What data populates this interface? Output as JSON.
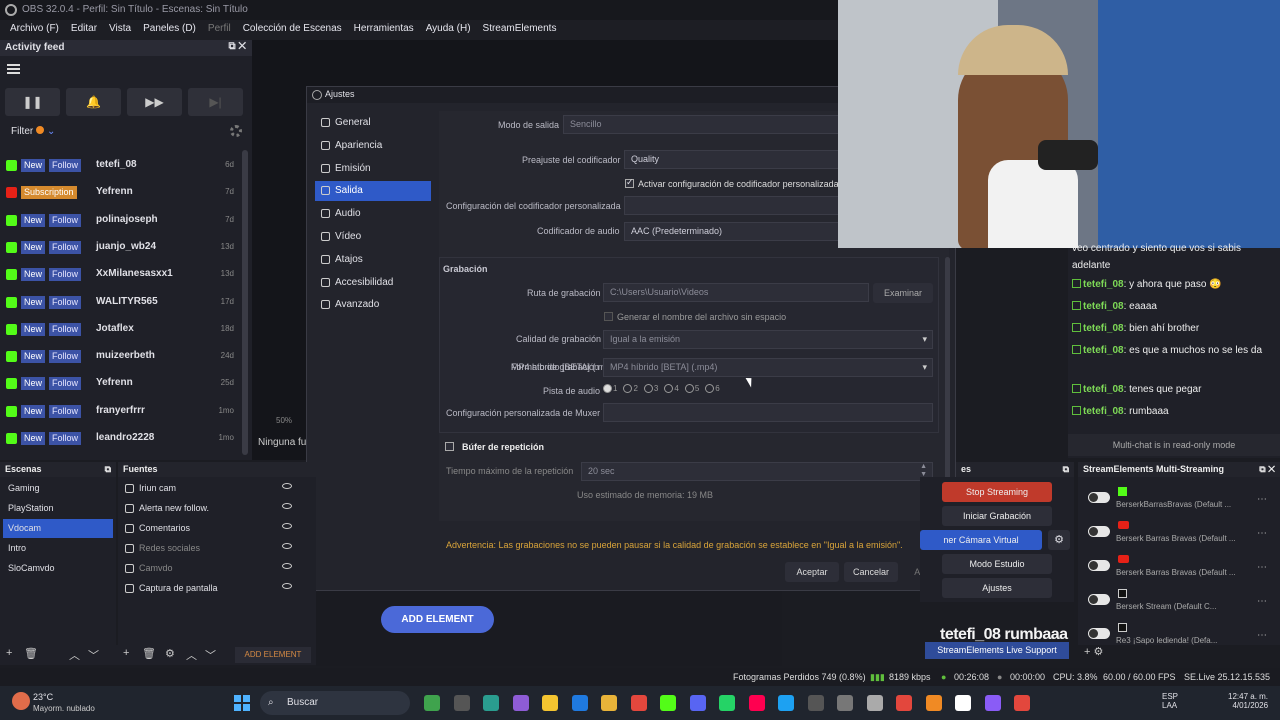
{
  "window": {
    "title": "OBS 32.0.4 - Perfil: Sin Título - Escenas: Sin Título"
  },
  "menu": [
    {
      "label": "Archivo (F)",
      "dim": false
    },
    {
      "label": "Editar",
      "dim": false
    },
    {
      "label": "Vista",
      "dim": false
    },
    {
      "label": "Paneles (D)",
      "dim": false
    },
    {
      "label": "Perfil",
      "dim": true
    },
    {
      "label": "Colección de Escenas",
      "dim": false
    },
    {
      "label": "Herramientas",
      "dim": false
    },
    {
      "label": "Ayuda (H)",
      "dim": false
    },
    {
      "label": "StreamElements",
      "dim": false
    }
  ],
  "feed": {
    "title": "Activity feed",
    "filter_label": "Filter",
    "items": [
      {
        "platform": "kick",
        "type": "New",
        "action": "Follow",
        "name": "tetefi_08",
        "time": "6d"
      },
      {
        "platform": "youtube",
        "type": "Subscription",
        "action": "",
        "name": "Yefrenn",
        "time": "7d"
      },
      {
        "platform": "kick",
        "type": "New",
        "action": "Follow",
        "name": "polinajoseph",
        "time": "7d"
      },
      {
        "platform": "kick",
        "type": "New",
        "action": "Follow",
        "name": "juanjo_wb24",
        "time": "13d"
      },
      {
        "platform": "kick",
        "type": "New",
        "action": "Follow",
        "name": "XxMilanesasxx1",
        "time": "13d"
      },
      {
        "platform": "kick",
        "type": "New",
        "action": "Follow",
        "name": "WALITYR565",
        "time": "17d"
      },
      {
        "platform": "kick",
        "type": "New",
        "action": "Follow",
        "name": "Jotaflex",
        "time": "18d"
      },
      {
        "platform": "kick",
        "type": "New",
        "action": "Follow",
        "name": "muizeerbeth",
        "time": "24d"
      },
      {
        "platform": "kick",
        "type": "New",
        "action": "Follow",
        "name": "Yefrenn",
        "time": "25d"
      },
      {
        "platform": "kick",
        "type": "New",
        "action": "Follow",
        "name": "franyerfrrr",
        "time": "1mo"
      },
      {
        "platform": "kick",
        "type": "New",
        "action": "Follow",
        "name": "leandro2228",
        "time": "1mo"
      }
    ]
  },
  "dialog": {
    "title": "Ajustes",
    "sidebar": [
      "General",
      "Apariencia",
      "Emisión",
      "Salida",
      "Audio",
      "Vídeo",
      "Atajos",
      "Accesibilidad",
      "Avanzado"
    ],
    "selected": "Salida",
    "output_mode_label": "Modo de salida",
    "output_mode_value": "Sencillo",
    "encoder_preset_label": "Preajuste del codificador",
    "encoder_preset_value": "Quality",
    "custom_encoder_check": "Activar configuración de codificador personalizada",
    "custom_encoder_label": "Configuración del codificador personalizada",
    "audio_encoder_label": "Codificador de audio",
    "audio_encoder_value": "AAC (Predeterminado)",
    "recording_section": "Grabación",
    "rec_path_label": "Ruta de grabación",
    "rec_path_value": "C:\\Users\\Usuario\\Videos",
    "browse_label": "Examinar",
    "gen_name_check": "Generar el nombre del archivo sin espacio",
    "rec_quality_label": "Calidad de grabación",
    "rec_quality_value": "Igual a la emisión",
    "rec_format_label": "Formato de grabación",
    "rec_format_value": "MP4 híbrido [BETA] (.mp4)",
    "audio_track_label": "Pista de audio",
    "audio_tracks": [
      "1",
      "2",
      "3",
      "4",
      "5",
      "6"
    ],
    "muxer_label": "Configuración personalizada de Muxer",
    "replay_buffer_label": "Búfer de repetición",
    "replay_max_label": "Tiempo máximo de la repetición",
    "replay_max_value": "20 sec",
    "memory_usage": "Uso estimado de memoria: 19 MB",
    "warning": "Advertencia: Las grabaciones no se pueden pausar si la calidad de grabación se establece en \"Igual a la emisión\".",
    "ok": "Aceptar",
    "cancel": "Cancelar",
    "apply": "Aplicar"
  },
  "preview": {
    "zoom": "50%",
    "no_source": "Ninguna fu",
    "add_element": "ADD ELEMENT"
  },
  "chat": {
    "lines": [
      {
        "user": "",
        "text": "veo centrado y siento que vos si sabis adelante"
      },
      {
        "user": "tetefi_08",
        "text": "y ahora que paso 😳"
      },
      {
        "user": "tetefi_08",
        "text": "eaaaa"
      },
      {
        "user": "tetefi_08",
        "text": "bien ahí brother"
      },
      {
        "user": "tetefi_08",
        "text": "es que a muchos no se les da"
      },
      {
        "user": "tetefi_08",
        "text": "tenes que pegar"
      },
      {
        "user": "tetefi_08",
        "text": "rumbaaa"
      }
    ],
    "footer": "Multi-chat is in read-only mode"
  },
  "scenes": {
    "title": "Escenas",
    "items": [
      "Gaming",
      "PlayStation",
      "Vdocam",
      "Intro",
      "SloCamvdo"
    ],
    "selected": "Vdocam"
  },
  "sources": {
    "title": "Fuentes",
    "items": [
      "Iriun cam",
      "Alerta new follow.",
      "Comentarios",
      "Redes sociales",
      "Camvdo",
      "Captura de pantalla"
    ],
    "add_element": "ADD ELEMENT"
  },
  "controls": {
    "title": "es",
    "stop": "Stop Streaming",
    "rec": "Iniciar Grabación",
    "vcam": "ner Cámara Virtual",
    "studio": "Modo Estudio",
    "settings": "Ajustes"
  },
  "se_multi": {
    "title": "StreamElements Multi-Streaming",
    "rows": [
      "BerserkBarrasBravas (Default ...",
      "Berserk Barras Bravas (Default ...",
      "Berserk Barras Bravas (Default ...",
      "Berserk Stream (Default C...",
      "Re3 ¡Sapo ledienda! (Defa..."
    ],
    "live_support": "StreamElements Live Support"
  },
  "overlay_text": "tetefi_08  rumbaaa",
  "status": {
    "dropped": "Fotogramas Perdidos 749 (0.8%)",
    "kbps": "8189 kbps",
    "live_time": "00:26:08",
    "rec_time": "00:00:00",
    "cpu": "CPU: 3.8%",
    "fps": "60.00 / 60.00 FPS",
    "version": "SE.Live 25.12.15.535"
  },
  "taskbar": {
    "temp": "23°C",
    "weather": "Mayorm. nublado",
    "search": "Buscar",
    "lang1": "ESP",
    "lang2": "LAA",
    "time": "12:47 a. m.",
    "date": "4/01/2026"
  }
}
